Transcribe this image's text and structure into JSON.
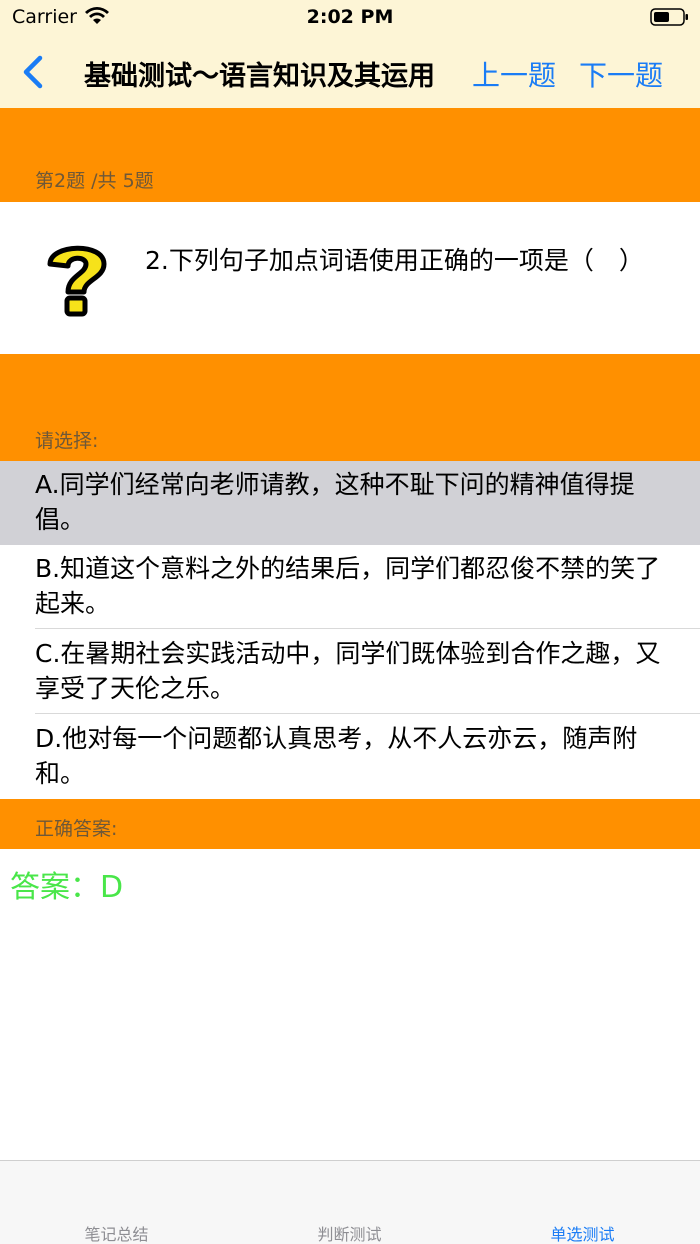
{
  "status_bar": {
    "carrier": "Carrier",
    "time": "2:02 PM"
  },
  "nav": {
    "title": "基础测试～语言知识及其运用",
    "prev_label": "上一题",
    "next_label": "下一题"
  },
  "question": {
    "counter": "第2题 /共 5题",
    "text": "2.下列句子加点词语使用正确的一项是（　）",
    "icon": "question-mark-icon"
  },
  "choices": {
    "header": "请选择:",
    "options": [
      {
        "text": "A.同学们经常向老师请教，这种不耻下问的精神值得提倡。",
        "selected": true
      },
      {
        "text": "B.知道这个意料之外的结果后，同学们都忍俊不禁的笑了起来。",
        "selected": false
      },
      {
        "text": "C.在暑期社会实践活动中，同学们既体验到合作之趣，又享受了天伦之乐。",
        "selected": false
      },
      {
        "text": "D.他对每一个问题都认真思考，从不人云亦云，随声附和。",
        "selected": false
      }
    ]
  },
  "answer": {
    "header": "正确答案:",
    "text": "答案：D"
  },
  "tabs": [
    {
      "label": "笔记总结",
      "active": false
    },
    {
      "label": "判断测试",
      "active": false
    },
    {
      "label": "单选测试",
      "active": true
    }
  ],
  "colors": {
    "accent": "#1a7cf5",
    "band": "#ff9000",
    "nav_bg": "#fdf5d6",
    "answer": "#49e649",
    "selected_bg": "#d1d1d6"
  }
}
